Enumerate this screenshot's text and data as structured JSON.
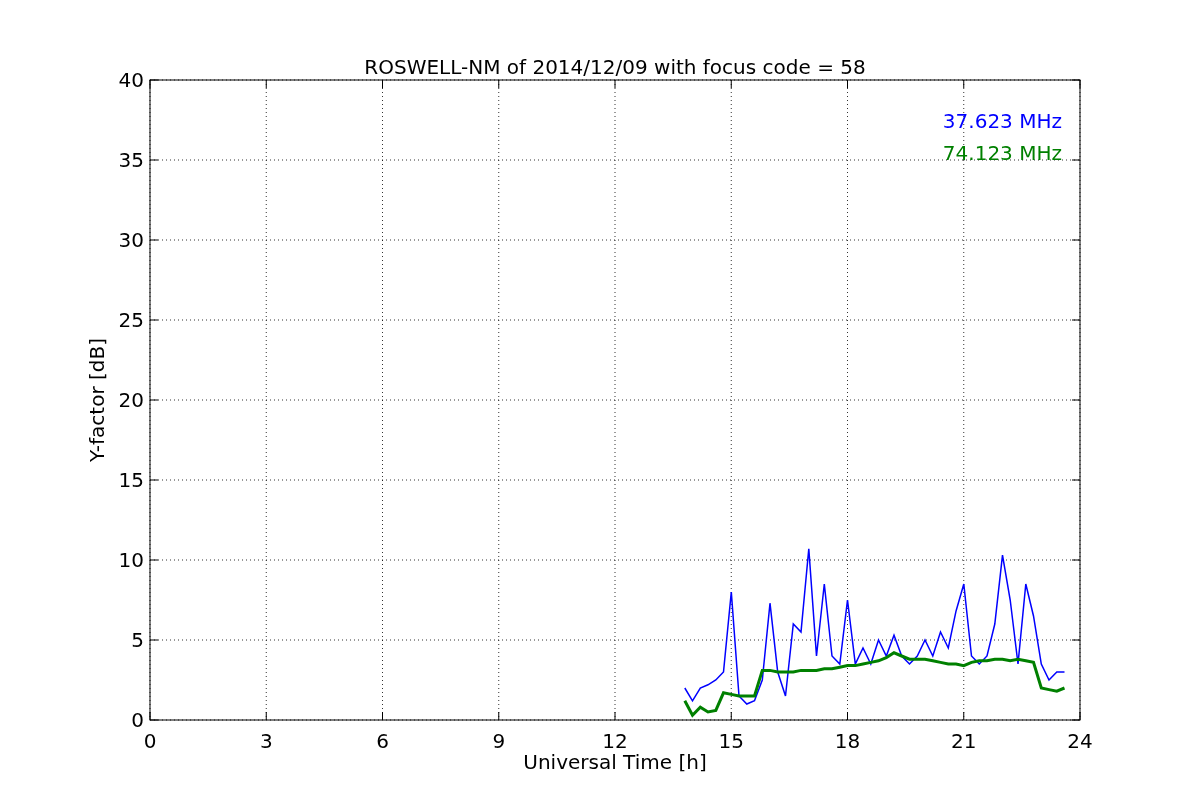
{
  "plot": {
    "chart_data": {
      "type": "line",
      "title": "ROSWELL-NM of 2014/12/09 with focus code = 58",
      "xlabel": "Universal Time [h]",
      "ylabel": "Y-factor [dB]",
      "x": [
        13.8,
        14.0,
        14.2,
        14.4,
        14.6,
        14.8,
        15.0,
        15.2,
        15.4,
        15.6,
        15.8,
        16.0,
        16.2,
        16.4,
        16.6,
        16.8,
        17.0,
        17.2,
        17.4,
        17.6,
        17.8,
        18.0,
        18.2,
        18.4,
        18.6,
        18.8,
        19.0,
        19.2,
        19.4,
        19.6,
        19.8,
        20.0,
        20.2,
        20.4,
        20.6,
        20.8,
        21.0,
        21.2,
        21.4,
        21.6,
        21.8,
        22.0,
        22.2,
        22.4,
        22.6,
        22.8,
        23.0,
        23.2,
        23.4,
        23.6
      ],
      "series": [
        {
          "name": "37.623 MHz",
          "color": "#0000ff",
          "values": [
            2.0,
            1.2,
            2.0,
            2.2,
            2.5,
            3.0,
            8.0,
            1.5,
            1.0,
            1.2,
            2.5,
            7.3,
            3.0,
            1.5,
            6.0,
            5.5,
            10.7,
            4.0,
            8.5,
            4.0,
            3.5,
            7.5,
            3.5,
            4.5,
            3.5,
            5.0,
            4.0,
            5.3,
            4.0,
            3.5,
            4.0,
            5.0,
            4.0,
            5.5,
            4.5,
            6.8,
            8.5,
            4.0,
            3.5,
            4.0,
            6.0,
            10.3,
            7.5,
            3.5,
            8.5,
            6.5,
            3.5,
            2.5,
            3.0,
            3.0
          ]
        },
        {
          "name": "74.123 MHz",
          "color": "#008000",
          "values": [
            1.2,
            0.3,
            0.8,
            0.5,
            0.6,
            1.7,
            1.6,
            1.5,
            1.5,
            1.5,
            3.1,
            3.1,
            3.0,
            3.0,
            3.0,
            3.1,
            3.1,
            3.1,
            3.2,
            3.2,
            3.3,
            3.4,
            3.4,
            3.5,
            3.6,
            3.7,
            3.9,
            4.2,
            4.0,
            3.8,
            3.8,
            3.8,
            3.7,
            3.6,
            3.5,
            3.5,
            3.4,
            3.6,
            3.7,
            3.7,
            3.8,
            3.8,
            3.7,
            3.8,
            3.7,
            3.6,
            2.0,
            1.9,
            1.8,
            2.0
          ]
        }
      ],
      "grid": true,
      "xlim": [
        0,
        24
      ],
      "ylim": [
        0,
        40
      ],
      "xticks": [
        0,
        3,
        6,
        9,
        12,
        15,
        18,
        21,
        24
      ],
      "yticks": [
        0,
        5,
        10,
        15,
        20,
        25,
        30,
        35,
        40
      ]
    }
  }
}
